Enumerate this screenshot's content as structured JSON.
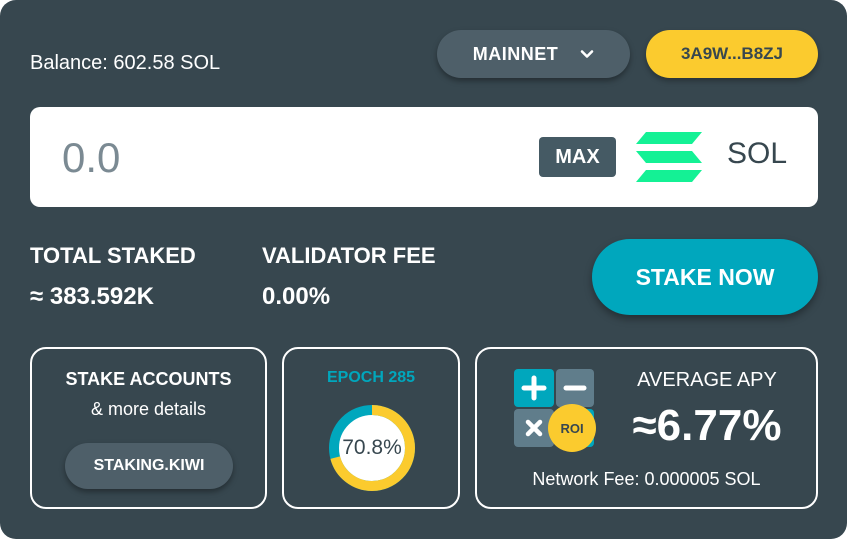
{
  "balance": {
    "text": "Balance: 602.58 SOL"
  },
  "network": {
    "label": "MAINNET",
    "chevron": "chevron-down-icon"
  },
  "wallet": {
    "label": "3A9W...B8ZJ"
  },
  "amount": {
    "placeholder": "0.0",
    "value": "",
    "max_label": "MAX",
    "currency": "SOL",
    "currency_icon": "solana-logo-icon"
  },
  "stats": {
    "total_staked_label": "TOTAL STAKED",
    "total_staked_value": "≈ 383.592K",
    "validator_fee_label": "VALIDATOR FEE",
    "validator_fee_value": "0.00%"
  },
  "stake_button": {
    "label": "STAKE NOW"
  },
  "accounts": {
    "title": "STAKE ACCOUNTS",
    "subtitle": "& more details",
    "button": "STAKING.KIWI"
  },
  "epoch": {
    "label": "EPOCH 285",
    "progress_text": "70.8%",
    "progress": 0.708
  },
  "apy": {
    "label": "AVERAGE APY",
    "value": "≈6.77%",
    "network_fee": "Network Fee: 0.000005 SOL",
    "calc_badge": "ROI",
    "calc_icon": "roi-calculator-icon"
  },
  "colors": {
    "background": "#37474f",
    "accent": "#00a7bd",
    "wallet": "#fbcb2e",
    "solana_green": "#14f195"
  }
}
